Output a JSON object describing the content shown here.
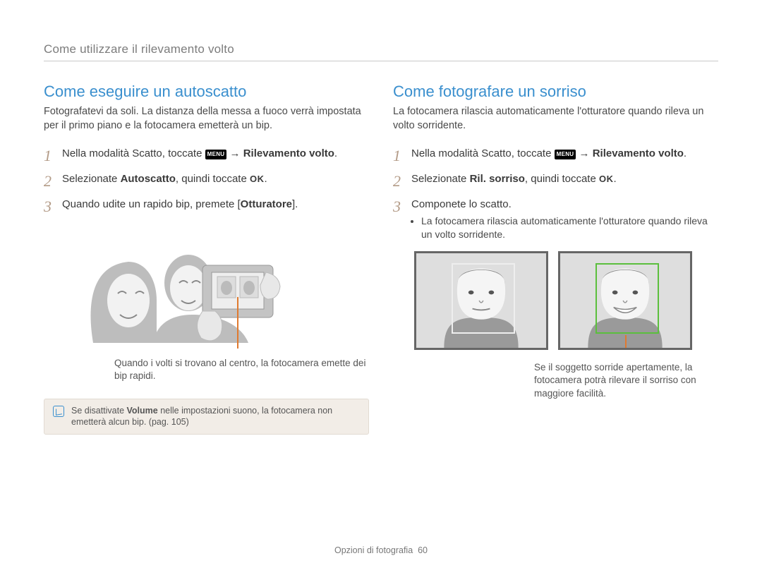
{
  "breadcrumb": "Come utilizzare il rilevamento volto",
  "left": {
    "title": "Come eseguire un autoscatto",
    "intro": "Fotografatevi da soli. La distanza della messa a fuoco verrà impostata per il primo piano e la fotocamera emetterà un bip.",
    "step1": {
      "num": "1",
      "pre": "Nella modalità Scatto, toccate ",
      "menu": "MENU",
      "arrow": " → ",
      "bold": "Rilevamento volto",
      "post": "."
    },
    "step2": {
      "num": "2",
      "pre": "Selezionate ",
      "bold": "Autoscatto",
      "post": ", quindi toccate ",
      "ok": "OK",
      "post2": "."
    },
    "step3": {
      "num": "3",
      "pre": "Quando udite un rapido bip, premete [",
      "bold": "Otturatore",
      "post": "]."
    },
    "caption": "Quando i volti si trovano al centro, la fotocamera emette dei bip rapidi.",
    "note": {
      "pre": "Se disattivate ",
      "bold": "Volume",
      "post": " nelle impostazioni suono, la fotocamera non emetterà alcun bip. (pag. 105)"
    }
  },
  "right": {
    "title": "Come fotografare un sorriso",
    "intro": "La fotocamera rilascia automaticamente l'otturatore quando rileva un volto sorridente.",
    "step1": {
      "num": "1",
      "pre": "Nella modalità Scatto, toccate ",
      "menu": "MENU",
      "arrow": " → ",
      "bold": "Rilevamento volto",
      "post": "."
    },
    "step2": {
      "num": "2",
      "pre": "Selezionate ",
      "bold": "Ril. sorriso",
      "post": ", quindi toccate ",
      "ok": "OK",
      "post2": "."
    },
    "step3": {
      "num": "3",
      "text": "Componete lo scatto."
    },
    "bullet": "La fotocamera rilascia automaticamente l'otturatore quando rileva un volto sorridente.",
    "caption": "Se il soggetto sorride apertamente, la fotocamera potrà rilevare il sorriso con maggiore facilità."
  },
  "footer": {
    "label": "Opzioni di fotografia",
    "page": "60"
  }
}
